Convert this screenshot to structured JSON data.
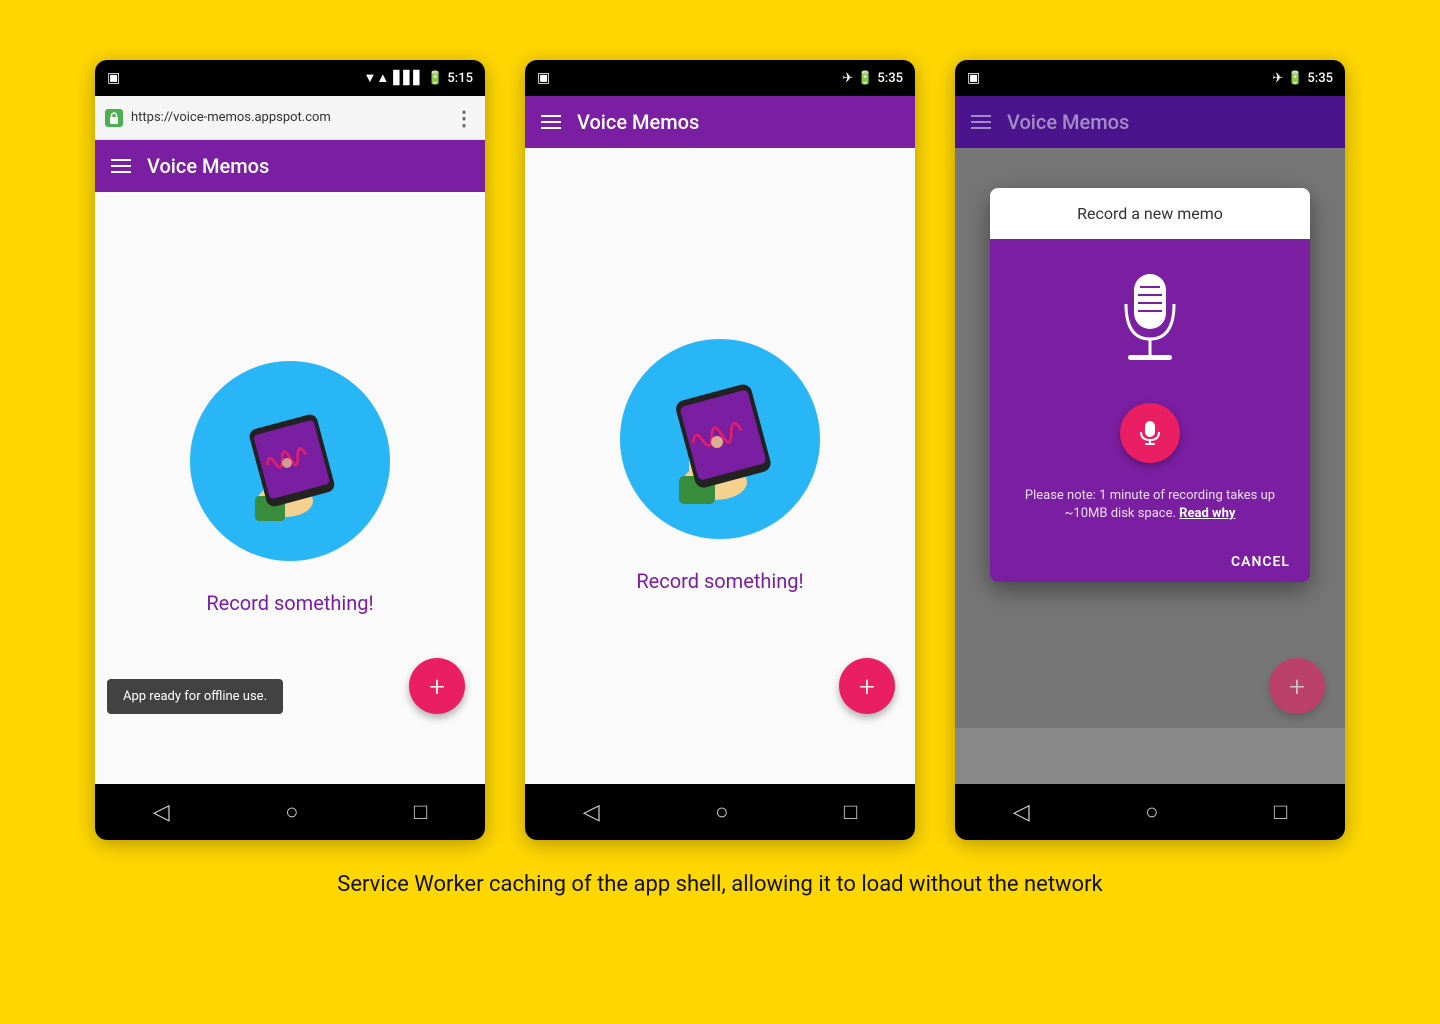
{
  "background_color": "#FFD700",
  "caption": "Service Worker caching of the app shell, allowing it to load without the network",
  "phones": [
    {
      "id": "phone1",
      "status_bar": {
        "left_icon": "notification-icon",
        "signal": "▼◀",
        "battery": "🔋",
        "time": "5:15"
      },
      "url_bar": {
        "url": "https://voice-memos.appspot.com",
        "show": true
      },
      "app_bar": {
        "title": "Voice Memos",
        "show_hamburger": true
      },
      "record_label": "Record something!",
      "snackbar": "App ready for offline use.",
      "show_snackbar": true,
      "fab_label": "+"
    },
    {
      "id": "phone2",
      "status_bar": {
        "time": "5:35"
      },
      "url_bar": {
        "show": false
      },
      "app_bar": {
        "title": "Voice Memos",
        "show_hamburger": true
      },
      "record_label": "Record something!",
      "show_snackbar": false,
      "fab_label": "+"
    },
    {
      "id": "phone3",
      "status_bar": {
        "time": "5:35"
      },
      "url_bar": {
        "show": false
      },
      "app_bar": {
        "title": "Voice Memos",
        "show_hamburger": true,
        "dimmed": true
      },
      "show_dialog": true,
      "dialog": {
        "title": "Record a new memo",
        "note": "Please note: 1 minute of recording takes up ~10MB disk space.",
        "read_why": "Read why",
        "cancel": "CANCEL"
      },
      "fab_label": "+"
    }
  ],
  "nav_icons": [
    "◁",
    "○",
    "□"
  ]
}
